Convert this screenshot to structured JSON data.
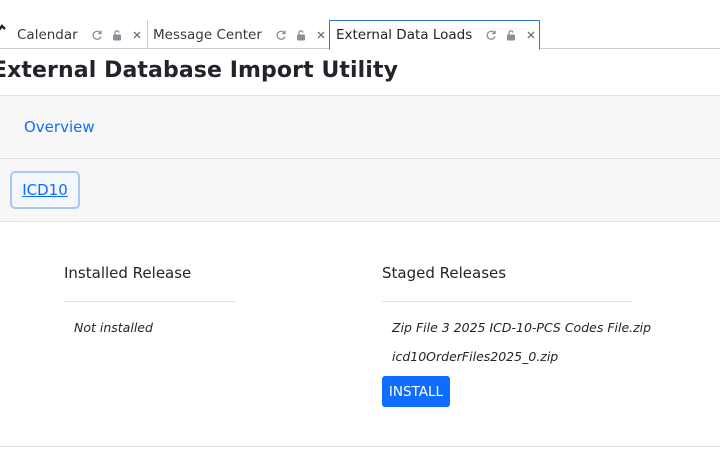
{
  "tabs": [
    {
      "label": "Calendar",
      "active": false
    },
    {
      "label": "Message Center",
      "active": false
    },
    {
      "label": "External Data Loads",
      "active": true
    }
  ],
  "tab_icons": [
    "refresh-icon",
    "lock-icon",
    "close-icon"
  ],
  "page": {
    "title": "External Database Import Utility"
  },
  "nav": {
    "overview_label": "Overview",
    "icd_tab_label": "ICD10"
  },
  "installed": {
    "heading": "Installed Release",
    "items": [
      "Not installed"
    ]
  },
  "staged": {
    "heading": "Staged Releases",
    "items": [
      "Zip File 3 2025 ICD-10-PCS Codes File.zip",
      "icd10OrderFiles2025_0.zip"
    ],
    "install_label": "INSTALL"
  },
  "colors": {
    "link": "#0d6efd",
    "button": "#0d6efd",
    "active_tab_border": "#2e78c7",
    "band_bg": "#f7f7f7"
  }
}
